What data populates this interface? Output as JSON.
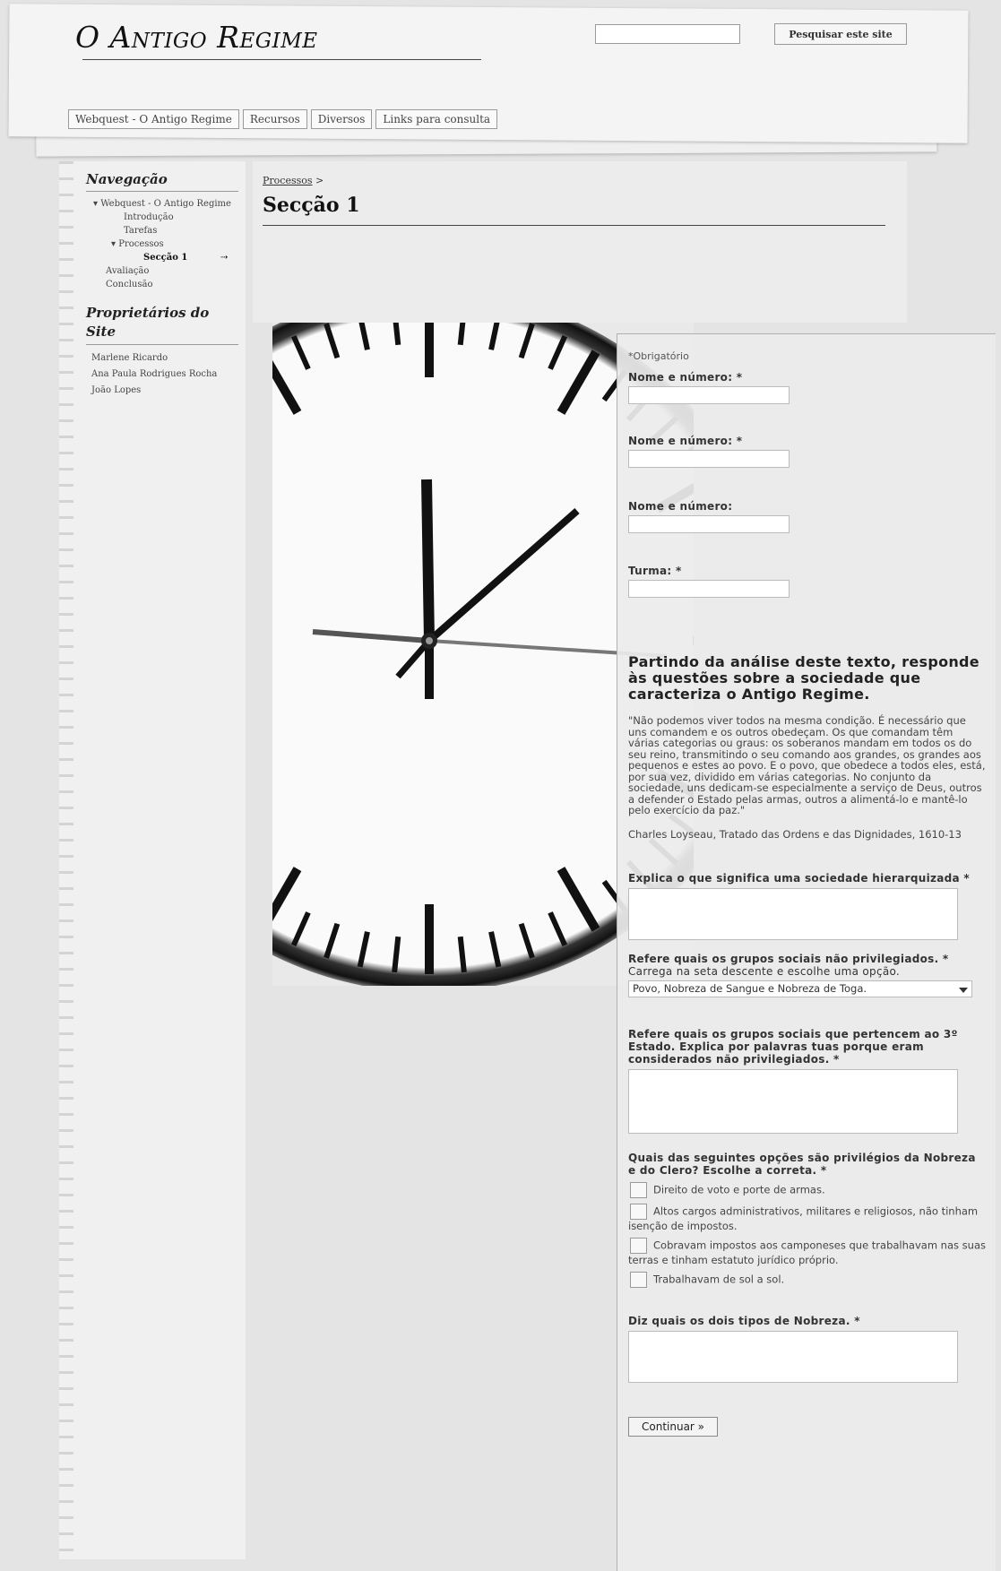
{
  "header": {
    "site_title": "O Antigo Regime",
    "search_placeholder": "",
    "search_button": "Pesquisar este site",
    "tabs": [
      "Webquest - O Antigo Regime",
      "Recursos",
      "Diversos",
      "Links para consulta"
    ]
  },
  "sidebar": {
    "nav_heading": "Navegação",
    "nav": {
      "root": "Webquest - O Antigo Regime",
      "intro": "Introdução",
      "tasks": "Tarefas",
      "processes": "Processos",
      "current": "Secção 1",
      "evaluation": "Avaliação",
      "conclusion": "Conclusão"
    },
    "owners_heading": "Proprietários do Site",
    "owners": [
      "Marlene Ricardo",
      "Ana Paula Rodrigues Rocha",
      "João Lopes"
    ]
  },
  "main": {
    "breadcrumb": "Processos",
    "breadcrumb_sep": ">",
    "title": "Secção 1"
  },
  "form": {
    "required_note": "*Obrigatório",
    "fields": [
      {
        "label": "Nome e número: *"
      },
      {
        "label": "Nome e número: *"
      },
      {
        "label": "Nome e número:"
      },
      {
        "label": "Turma: *"
      }
    ],
    "section_title": "Partindo da análise deste texto, responde às questões sobre a sociedade que caracteriza o Antigo Regime.",
    "quote": "\"Não podemos viver todos na mesma condição. É necessário que uns comandem e os outros obedeçam. Os que comandam têm várias categorias ou graus: os soberanos mandam em todos os do seu reino, transmitindo o seu comando aos grandes, os grandes aos pequenos e estes ao povo. E o povo, que obedece a todos eles, está, por sua vez, dividido em várias categorias. No conjunto da sociedade, uns dedicam-se especialmente a serviço de Deus, outros a defender o Estado pelas armas, outros a alimentá-lo e mantê-lo pelo exercício da paz.\"",
    "citation": "Charles Loyseau, Tratado das Ordens e das Dignidades, 1610-13",
    "q1": "Explica o que significa uma sociedade hierarquizada *",
    "q2": "Refere quais os grupos sociais não privilegiados. *",
    "q2_hint": "Carrega na seta descente e escolhe uma opção.",
    "q2_selected": "Povo, Nobreza de Sangue e Nobreza de Toga.",
    "q3": "Refere quais os grupos sociais que pertencem ao 3º Estado. Explica por palavras tuas porque eram considerados não privilegiados. *",
    "q4": "Quais das seguintes opções são privilégios da Nobreza e do Clero? Escolhe a correta. *",
    "q4_options": [
      "Direito de voto e porte de armas.",
      "Altos cargos administrativos, militares e religiosos, não tinham isenção de impostos.",
      "Cobravam impostos aos camponeses que trabalhavam nas suas terras e tinham estatuto jurídico próprio.",
      "Trabalhavam de sol a sol."
    ],
    "q5": "Diz quais os dois tipos de Nobreza. *",
    "continue_button": "Continuar »"
  }
}
